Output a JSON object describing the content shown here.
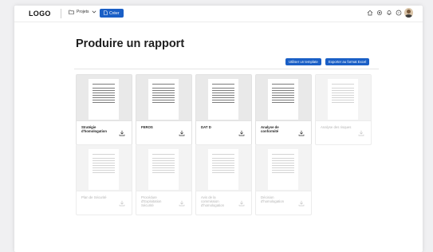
{
  "topbar": {
    "logo": "LOGO",
    "projects_label": "Projets",
    "create_label": "Créer"
  },
  "page": {
    "title": "Produire un rapport"
  },
  "actions": {
    "template_label": "Utiliser un template",
    "excel_label": "Exporter au format Excel"
  },
  "documents": [
    {
      "label": "Stratégie d'homologation",
      "enabled": true,
      "icon": "download-icon"
    },
    {
      "label": "FEROS",
      "enabled": true,
      "icon": "download-icon"
    },
    {
      "label": "DAT D",
      "enabled": true,
      "icon": "download-icon"
    },
    {
      "label": "Analyse de conformité",
      "enabled": true,
      "icon": "download-icon"
    },
    {
      "label": "Analyse des risques",
      "enabled": false,
      "icon": "download-icon"
    },
    {
      "label": "Plan de Sécurité",
      "enabled": false,
      "icon": "download-icon"
    },
    {
      "label": "Procédure d'Exploitation Sécurité",
      "enabled": false,
      "icon": "download-icon"
    },
    {
      "label": "Avis de la commission d'homologation",
      "enabled": false,
      "icon": "download-icon"
    },
    {
      "label": "Décision d'homologation",
      "enabled": false,
      "icon": "download-icon"
    }
  ],
  "colors": {
    "accent": "#1a5fc6",
    "disabled_text": "#b4b4b4"
  }
}
